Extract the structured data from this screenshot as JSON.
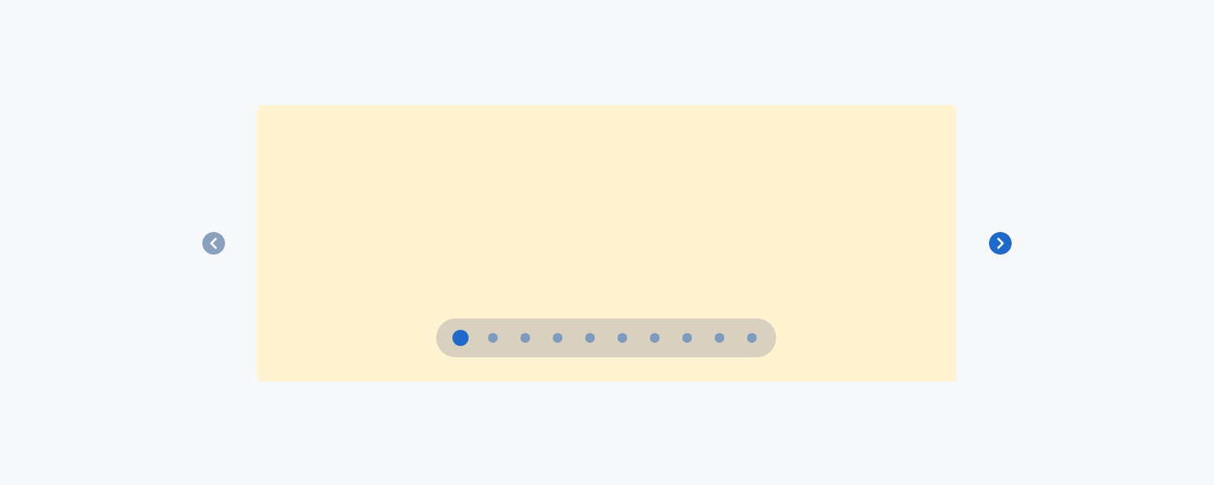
{
  "carousel": {
    "slide_count": 10,
    "active_index": 0,
    "prev_button": {
      "icon": "chevron-left-icon",
      "state": "disabled"
    },
    "next_button": {
      "icon": "chevron-right-icon",
      "state": "enabled"
    }
  },
  "colors": {
    "page_background": "#f7f8fa",
    "slide_background": "#fff3d1",
    "dots_track": "#d8d1c0",
    "dot_inactive": "#7f9bbd",
    "dot_active": "#1f6ac8",
    "button_disabled": "#8aa0bd",
    "button_enabled": "#1f6ac8"
  }
}
